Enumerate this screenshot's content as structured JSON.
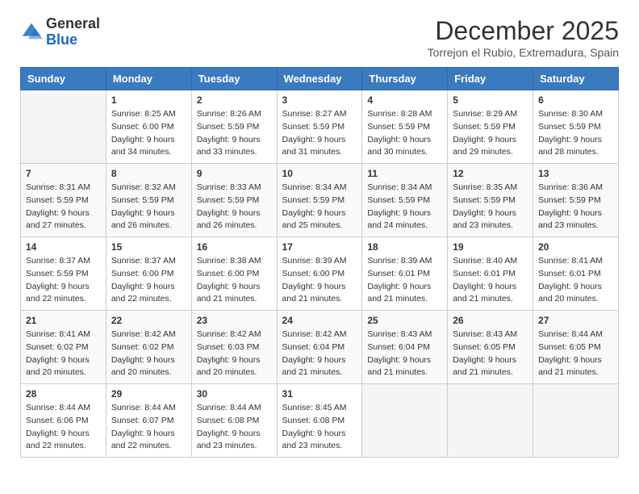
{
  "header": {
    "logo_line1": "General",
    "logo_line2": "Blue",
    "month": "December 2025",
    "location": "Torrejon el Rubio, Extremadura, Spain"
  },
  "days_of_week": [
    "Sunday",
    "Monday",
    "Tuesday",
    "Wednesday",
    "Thursday",
    "Friday",
    "Saturday"
  ],
  "weeks": [
    [
      {
        "day": "",
        "sunrise": "",
        "sunset": "",
        "daylight": ""
      },
      {
        "day": "1",
        "sunrise": "Sunrise: 8:25 AM",
        "sunset": "Sunset: 6:00 PM",
        "daylight": "Daylight: 9 hours and 34 minutes."
      },
      {
        "day": "2",
        "sunrise": "Sunrise: 8:26 AM",
        "sunset": "Sunset: 5:59 PM",
        "daylight": "Daylight: 9 hours and 33 minutes."
      },
      {
        "day": "3",
        "sunrise": "Sunrise: 8:27 AM",
        "sunset": "Sunset: 5:59 PM",
        "daylight": "Daylight: 9 hours and 31 minutes."
      },
      {
        "day": "4",
        "sunrise": "Sunrise: 8:28 AM",
        "sunset": "Sunset: 5:59 PM",
        "daylight": "Daylight: 9 hours and 30 minutes."
      },
      {
        "day": "5",
        "sunrise": "Sunrise: 8:29 AM",
        "sunset": "Sunset: 5:59 PM",
        "daylight": "Daylight: 9 hours and 29 minutes."
      },
      {
        "day": "6",
        "sunrise": "Sunrise: 8:30 AM",
        "sunset": "Sunset: 5:59 PM",
        "daylight": "Daylight: 9 hours and 28 minutes."
      }
    ],
    [
      {
        "day": "7",
        "sunrise": "Sunrise: 8:31 AM",
        "sunset": "Sunset: 5:59 PM",
        "daylight": "Daylight: 9 hours and 27 minutes."
      },
      {
        "day": "8",
        "sunrise": "Sunrise: 8:32 AM",
        "sunset": "Sunset: 5:59 PM",
        "daylight": "Daylight: 9 hours and 26 minutes."
      },
      {
        "day": "9",
        "sunrise": "Sunrise: 8:33 AM",
        "sunset": "Sunset: 5:59 PM",
        "daylight": "Daylight: 9 hours and 26 minutes."
      },
      {
        "day": "10",
        "sunrise": "Sunrise: 8:34 AM",
        "sunset": "Sunset: 5:59 PM",
        "daylight": "Daylight: 9 hours and 25 minutes."
      },
      {
        "day": "11",
        "sunrise": "Sunrise: 8:34 AM",
        "sunset": "Sunset: 5:59 PM",
        "daylight": "Daylight: 9 hours and 24 minutes."
      },
      {
        "day": "12",
        "sunrise": "Sunrise: 8:35 AM",
        "sunset": "Sunset: 5:59 PM",
        "daylight": "Daylight: 9 hours and 23 minutes."
      },
      {
        "day": "13",
        "sunrise": "Sunrise: 8:36 AM",
        "sunset": "Sunset: 5:59 PM",
        "daylight": "Daylight: 9 hours and 23 minutes."
      }
    ],
    [
      {
        "day": "14",
        "sunrise": "Sunrise: 8:37 AM",
        "sunset": "Sunset: 5:59 PM",
        "daylight": "Daylight: 9 hours and 22 minutes."
      },
      {
        "day": "15",
        "sunrise": "Sunrise: 8:37 AM",
        "sunset": "Sunset: 6:00 PM",
        "daylight": "Daylight: 9 hours and 22 minutes."
      },
      {
        "day": "16",
        "sunrise": "Sunrise: 8:38 AM",
        "sunset": "Sunset: 6:00 PM",
        "daylight": "Daylight: 9 hours and 21 minutes."
      },
      {
        "day": "17",
        "sunrise": "Sunrise: 8:39 AM",
        "sunset": "Sunset: 6:00 PM",
        "daylight": "Daylight: 9 hours and 21 minutes."
      },
      {
        "day": "18",
        "sunrise": "Sunrise: 8:39 AM",
        "sunset": "Sunset: 6:01 PM",
        "daylight": "Daylight: 9 hours and 21 minutes."
      },
      {
        "day": "19",
        "sunrise": "Sunrise: 8:40 AM",
        "sunset": "Sunset: 6:01 PM",
        "daylight": "Daylight: 9 hours and 21 minutes."
      },
      {
        "day": "20",
        "sunrise": "Sunrise: 8:41 AM",
        "sunset": "Sunset: 6:01 PM",
        "daylight": "Daylight: 9 hours and 20 minutes."
      }
    ],
    [
      {
        "day": "21",
        "sunrise": "Sunrise: 8:41 AM",
        "sunset": "Sunset: 6:02 PM",
        "daylight": "Daylight: 9 hours and 20 minutes."
      },
      {
        "day": "22",
        "sunrise": "Sunrise: 8:42 AM",
        "sunset": "Sunset: 6:02 PM",
        "daylight": "Daylight: 9 hours and 20 minutes."
      },
      {
        "day": "23",
        "sunrise": "Sunrise: 8:42 AM",
        "sunset": "Sunset: 6:03 PM",
        "daylight": "Daylight: 9 hours and 20 minutes."
      },
      {
        "day": "24",
        "sunrise": "Sunrise: 8:42 AM",
        "sunset": "Sunset: 6:04 PM",
        "daylight": "Daylight: 9 hours and 21 minutes."
      },
      {
        "day": "25",
        "sunrise": "Sunrise: 8:43 AM",
        "sunset": "Sunset: 6:04 PM",
        "daylight": "Daylight: 9 hours and 21 minutes."
      },
      {
        "day": "26",
        "sunrise": "Sunrise: 8:43 AM",
        "sunset": "Sunset: 6:05 PM",
        "daylight": "Daylight: 9 hours and 21 minutes."
      },
      {
        "day": "27",
        "sunrise": "Sunrise: 8:44 AM",
        "sunset": "Sunset: 6:05 PM",
        "daylight": "Daylight: 9 hours and 21 minutes."
      }
    ],
    [
      {
        "day": "28",
        "sunrise": "Sunrise: 8:44 AM",
        "sunset": "Sunset: 6:06 PM",
        "daylight": "Daylight: 9 hours and 22 minutes."
      },
      {
        "day": "29",
        "sunrise": "Sunrise: 8:44 AM",
        "sunset": "Sunset: 6:07 PM",
        "daylight": "Daylight: 9 hours and 22 minutes."
      },
      {
        "day": "30",
        "sunrise": "Sunrise: 8:44 AM",
        "sunset": "Sunset: 6:08 PM",
        "daylight": "Daylight: 9 hours and 23 minutes."
      },
      {
        "day": "31",
        "sunrise": "Sunrise: 8:45 AM",
        "sunset": "Sunset: 6:08 PM",
        "daylight": "Daylight: 9 hours and 23 minutes."
      },
      {
        "day": "",
        "sunrise": "",
        "sunset": "",
        "daylight": ""
      },
      {
        "day": "",
        "sunrise": "",
        "sunset": "",
        "daylight": ""
      },
      {
        "day": "",
        "sunrise": "",
        "sunset": "",
        "daylight": ""
      }
    ]
  ]
}
